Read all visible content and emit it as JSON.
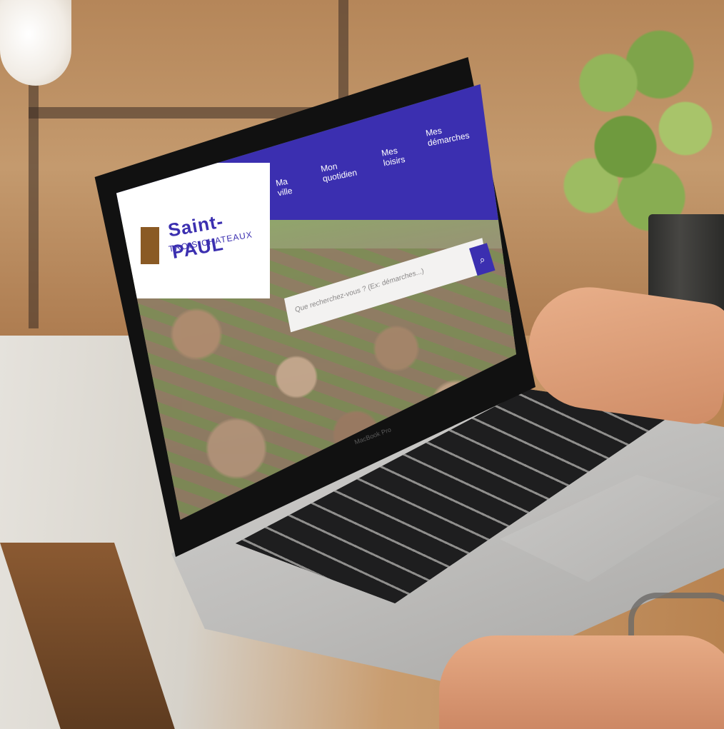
{
  "site": {
    "logo_title": "Saint-PAUL",
    "logo_subtitle": "TROIS-CHATEAUX"
  },
  "nav": {
    "items": [
      {
        "label": "Ma\nville"
      },
      {
        "label": "Mon\nquotidien"
      },
      {
        "label": "Mes\nloisirs"
      },
      {
        "label": "Mes\ndémarches"
      }
    ]
  },
  "search": {
    "placeholder": "Que recherchez-vous ? (Ex: démarches...)"
  },
  "device": {
    "brand": "MacBook Pro"
  },
  "colors": {
    "brand_blue": "#3b2fb0",
    "logo_brown": "#8a5a24"
  },
  "icons": {
    "search_button": "search-icon"
  }
}
